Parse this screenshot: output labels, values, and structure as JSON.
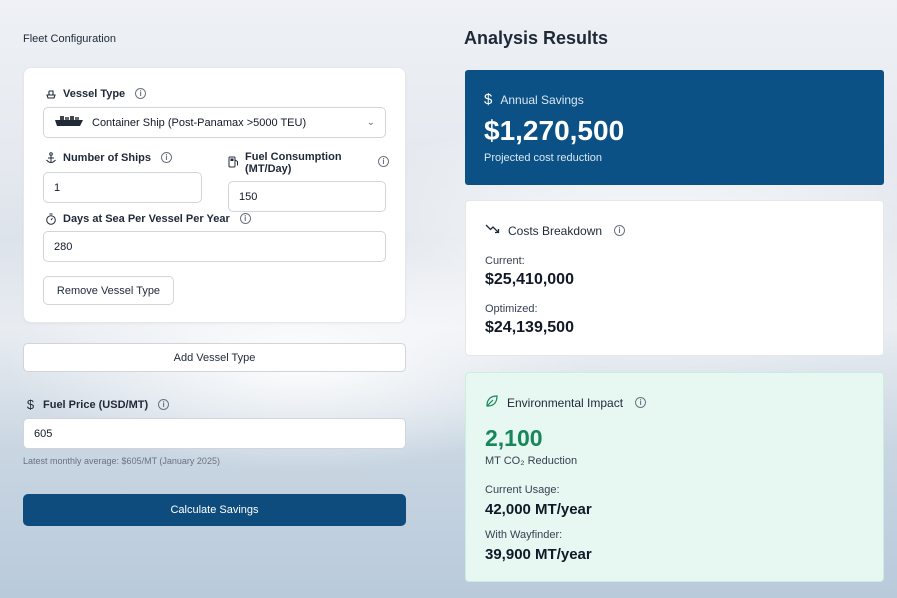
{
  "left": {
    "section_title": "Fleet Configuration",
    "vessel": {
      "type_label": "Vessel Type",
      "type_value": "Container Ship (Post-Panamax >5000 TEU)",
      "ships_label": "Number of Ships",
      "ships_value": "1",
      "fuel_label": "Fuel Consumption (MT/Day)",
      "fuel_value": "150",
      "days_label": "Days at Sea Per Vessel Per Year",
      "days_value": "280",
      "remove_label": "Remove Vessel Type"
    },
    "add_label": "Add Vessel Type",
    "price_label": "Fuel Price (USD/MT)",
    "price_value": "605",
    "price_hint": "Latest monthly average: $605/MT (January 2025)",
    "calculate_label": "Calculate Savings"
  },
  "results": {
    "title": "Analysis Results",
    "savings": {
      "label": "Annual Savings",
      "value": "$1,270,500",
      "sub": "Projected cost reduction"
    },
    "costs": {
      "label": "Costs Breakdown",
      "current_label": "Current:",
      "current_value": "$25,410,000",
      "optimized_label": "Optimized:",
      "optimized_value": "$24,139,500"
    },
    "env": {
      "label": "Environmental Impact",
      "value": "2,100",
      "sub": "MT CO₂ Reduction",
      "current_label": "Current Usage:",
      "current_value": "42,000 MT/year",
      "wayfinder_label": "With Wayfinder:",
      "wayfinder_value": "39,900 MT/year"
    }
  },
  "colors": {
    "primary": "#0d4c7d",
    "savings_bg": "#0b5185",
    "env_bg": "#e6f8f1",
    "env_accent": "#15875a"
  }
}
